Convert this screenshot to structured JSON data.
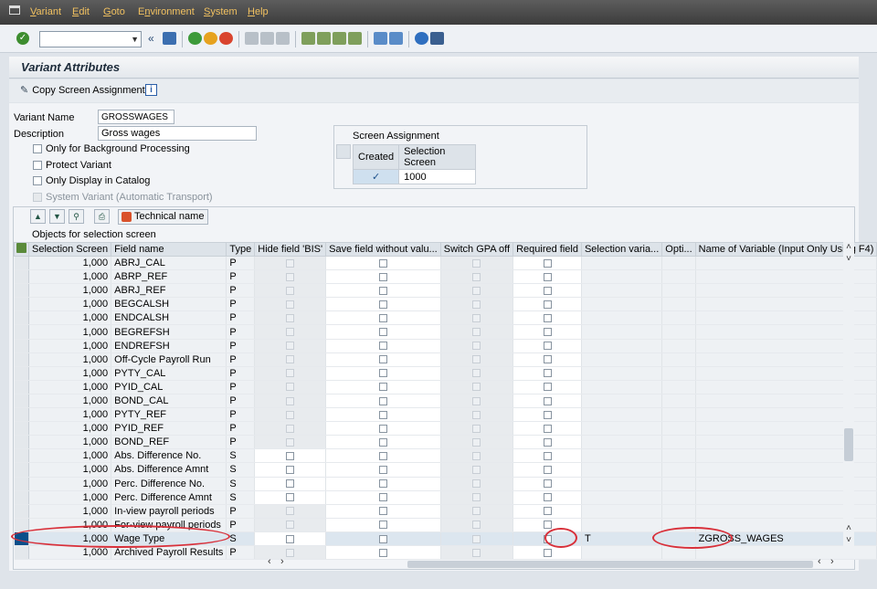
{
  "menu": [
    "Variant",
    "Edit",
    "Goto",
    "Environment",
    "System",
    "Help"
  ],
  "menu_underline": [
    "V",
    "E",
    "G",
    "n",
    "S",
    "H"
  ],
  "screen_title": "Variant Attributes",
  "app_toolbar": {
    "copy_label": "Copy Screen Assignment"
  },
  "form": {
    "variant_name_label": "Variant Name",
    "variant_name_value": "GROSSWAGES",
    "description_label": "Description",
    "description_value": "Gross wages",
    "checks": [
      {
        "label": "Only for Background Processing",
        "checked": false,
        "disabled": false
      },
      {
        "label": "Protect Variant",
        "checked": false,
        "disabled": false
      },
      {
        "label": "Only Display in Catalog",
        "checked": false,
        "disabled": false
      },
      {
        "label": "System Variant (Automatic Transport)",
        "checked": false,
        "disabled": true
      }
    ]
  },
  "screen_assignment": {
    "title": "Screen Assignment",
    "headers": [
      "Created",
      "Selection Screen"
    ],
    "rows": [
      {
        "created": "✓",
        "screen": "1000"
      }
    ]
  },
  "grid": {
    "technical_name_label": "Technical name",
    "title": "Objects for selection screen",
    "headers": [
      "Selection Screen",
      "Field name",
      "Type",
      "Hide field 'BIS'",
      "Save field without valu...",
      "Switch GPA off",
      "Required field",
      "Selection varia...",
      "Opti...",
      "Name of Variable (Input Only Using F4)"
    ],
    "rows": [
      {
        "screen": "1,000",
        "field": "ABRJ_CAL",
        "type": "P",
        "sel": "",
        "var": "",
        "active": false
      },
      {
        "screen": "1,000",
        "field": "ABRP_REF",
        "type": "P",
        "sel": "",
        "var": "",
        "active": false
      },
      {
        "screen": "1,000",
        "field": "ABRJ_REF",
        "type": "P",
        "sel": "",
        "var": "",
        "active": false
      },
      {
        "screen": "1,000",
        "field": "BEGCALSH",
        "type": "P",
        "sel": "",
        "var": "",
        "active": false
      },
      {
        "screen": "1,000",
        "field": "ENDCALSH",
        "type": "P",
        "sel": "",
        "var": "",
        "active": false
      },
      {
        "screen": "1,000",
        "field": "BEGREFSH",
        "type": "P",
        "sel": "",
        "var": "",
        "active": false
      },
      {
        "screen": "1,000",
        "field": "ENDREFSH",
        "type": "P",
        "sel": "",
        "var": "",
        "active": false
      },
      {
        "screen": "1,000",
        "field": "Off-Cycle Payroll Run",
        "type": "P",
        "sel": "",
        "var": "",
        "active": false
      },
      {
        "screen": "1,000",
        "field": "PYTY_CAL",
        "type": "P",
        "sel": "",
        "var": "",
        "active": false
      },
      {
        "screen": "1,000",
        "field": "PYID_CAL",
        "type": "P",
        "sel": "",
        "var": "",
        "active": false
      },
      {
        "screen": "1,000",
        "field": "BOND_CAL",
        "type": "P",
        "sel": "",
        "var": "",
        "active": false
      },
      {
        "screen": "1,000",
        "field": "PYTY_REF",
        "type": "P",
        "sel": "",
        "var": "",
        "active": false
      },
      {
        "screen": "1,000",
        "field": "PYID_REF",
        "type": "P",
        "sel": "",
        "var": "",
        "active": false
      },
      {
        "screen": "1,000",
        "field": "BOND_REF",
        "type": "P",
        "sel": "",
        "var": "",
        "active": false
      },
      {
        "screen": "1,000",
        "field": "Abs. Difference No.",
        "type": "S",
        "sel": "",
        "var": "",
        "active": true
      },
      {
        "screen": "1,000",
        "field": "Abs. Difference Amnt",
        "type": "S",
        "sel": "",
        "var": "",
        "active": true
      },
      {
        "screen": "1,000",
        "field": "Perc. Difference No.",
        "type": "S",
        "sel": "",
        "var": "",
        "active": true
      },
      {
        "screen": "1,000",
        "field": "Perc. Difference Amnt",
        "type": "S",
        "sel": "",
        "var": "",
        "active": true
      },
      {
        "screen": "1,000",
        "field": "In-view payroll periods",
        "type": "P",
        "sel": "",
        "var": "",
        "active": false
      },
      {
        "screen": "1,000",
        "field": "For-view payroll periods",
        "type": "P",
        "sel": "",
        "var": "",
        "active": false
      },
      {
        "screen": "1,000",
        "field": "Wage Type",
        "type": "S",
        "sel": "T",
        "var": "ZGROSS_WAGES",
        "active": true,
        "highlight": true
      },
      {
        "screen": "1,000",
        "field": "Archived Payroll Results",
        "type": "P",
        "sel": "",
        "var": "",
        "active": false
      }
    ]
  },
  "colors": {
    "menubar": "#4a4a4a",
    "menu_text": "#f0c060",
    "highlight_row": "#dce6ef",
    "selected_marker": "#0a4f8a",
    "annotation": "#d8303a"
  }
}
